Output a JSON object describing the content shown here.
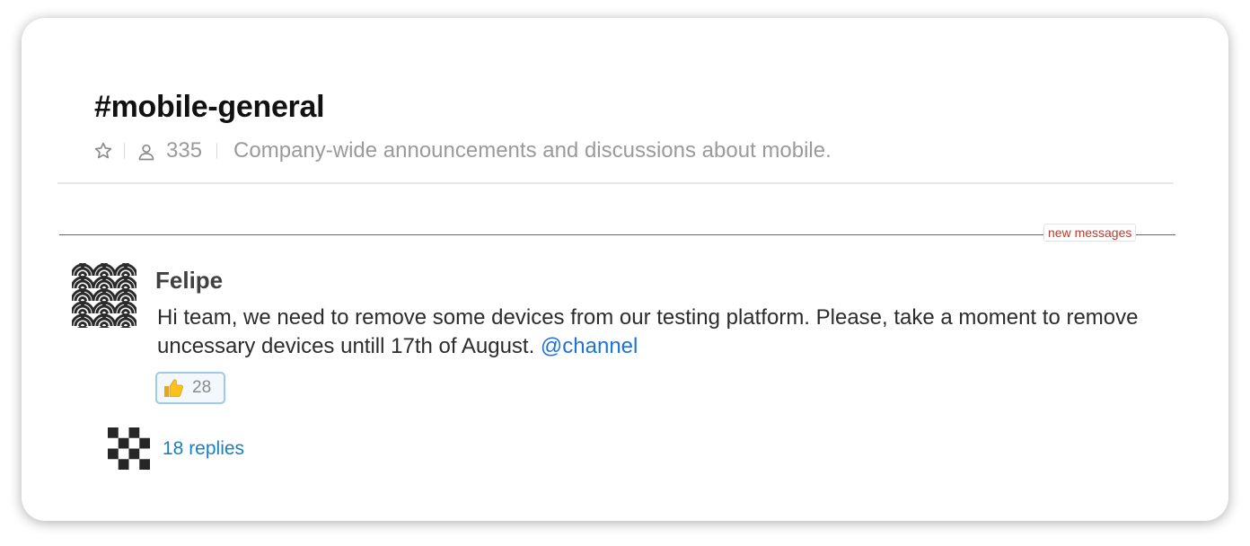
{
  "channel": {
    "name": "#mobile-general",
    "member_count": "335",
    "description": "Company-wide announcements and discussions about mobile.",
    "star_icon": "star-outline-icon",
    "members_icon": "person-icon"
  },
  "divider": {
    "new_messages_label": "new messages",
    "color": "#d23a3a"
  },
  "message": {
    "sender": "Felipe",
    "avatar_icon": "wave-pattern-avatar",
    "text": "Hi team, we need to remove some devices from our testing platform. Please, take a moment to remove uncessary devices untill 17th of August.",
    "mention": "@channel",
    "mention_color": "#1d74d6",
    "reaction": {
      "emoji": "thumbs-up-icon",
      "count": "28"
    },
    "thread": {
      "avatar_icon": "checker-pattern-avatar",
      "replies_label": "18 replies",
      "link_color": "#1a7fc1"
    }
  }
}
